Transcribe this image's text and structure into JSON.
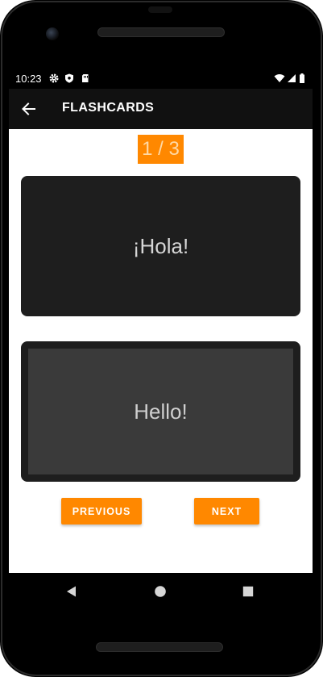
{
  "status_bar": {
    "time": "10:23",
    "left_icons": [
      "gear-icon",
      "shield-icon",
      "sim-card-icon"
    ],
    "right_icons": [
      "wifi-icon",
      "signal-icon",
      "battery-icon"
    ]
  },
  "toolbar": {
    "back_icon": "arrow-left-icon",
    "title": "FLASHCARDS"
  },
  "counter": {
    "text": "1 / 3"
  },
  "cards": {
    "front_text": "¡Hola!",
    "back_text": "Hello!"
  },
  "buttons": {
    "previous_label": "PREVIOUS",
    "next_label": "NEXT"
  },
  "navigation": {
    "back_icon": "triangle-back-icon",
    "home_icon": "circle-home-icon",
    "recents_icon": "square-recents-icon"
  },
  "colors": {
    "accent": "#ff8800",
    "card_dark": "#1e1e1e",
    "card_inner": "#3a3a3a",
    "toolbar": "#111111"
  }
}
